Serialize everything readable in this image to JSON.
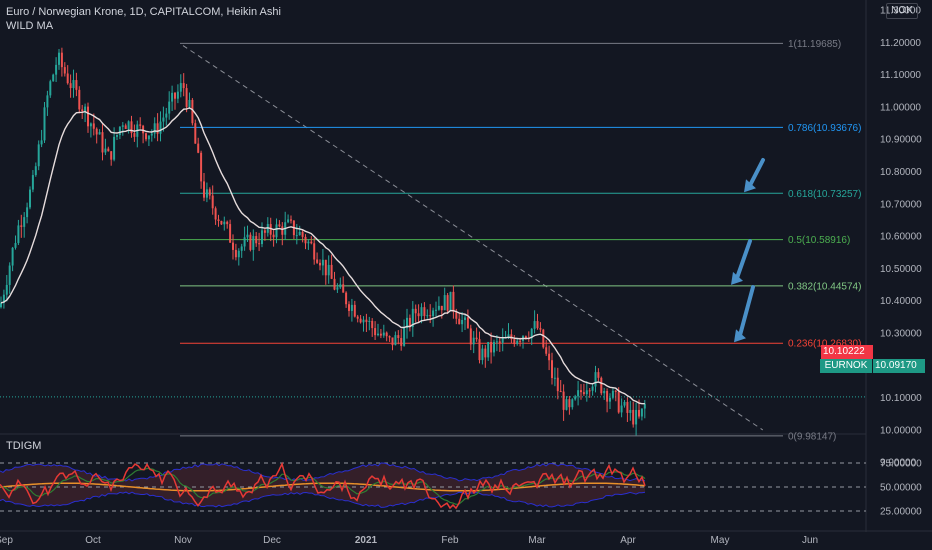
{
  "header": {
    "symbol_line": "Euro / Norwegian Krone, 1D, CAPITALCOM, Heikin Ashi",
    "indicator": "WILD MA",
    "oscillator": "TDIGM",
    "currency": "NOK"
  },
  "price_axis": {
    "ticks": [
      "11.30000",
      "11.20000",
      "11.10000",
      "11.00000",
      "10.90000",
      "10.80000",
      "10.70000",
      "10.60000",
      "10.50000",
      "10.40000",
      "10.30000",
      "10.20000",
      "10.10000",
      "10.00000",
      "9.90000"
    ],
    "tick_values": [
      11.3,
      11.2,
      11.1,
      11.0,
      10.9,
      10.8,
      10.7,
      10.6,
      10.5,
      10.4,
      10.3,
      10.2,
      10.1,
      10.0,
      9.9
    ]
  },
  "osc_axis": {
    "ticks": [
      "75.00000",
      "50.00000",
      "25.00000"
    ],
    "tick_values": [
      75,
      50,
      25
    ]
  },
  "time_axis": {
    "ticks": [
      "Sep",
      "Oct",
      "Nov",
      "Dec",
      "2021",
      "Feb",
      "Mar",
      "Apr",
      "May",
      "Jun"
    ]
  },
  "tags": {
    "last_price": "10.10222",
    "symbol": "EURNOK",
    "symbol_price": "10.09170"
  },
  "chart_data": {
    "type": "candlestick",
    "symbol": "EURNOK",
    "interval": "1D",
    "style": "Heikin Ashi",
    "ylim": [
      9.87,
      11.32
    ],
    "fib_levels": [
      {
        "ratio": "1",
        "value": 11.19685,
        "label": "1(11.19685)",
        "color": "#787b86"
      },
      {
        "ratio": "0.786",
        "value": 10.93676,
        "label": "0.786(10.93676)",
        "color": "#2196f3"
      },
      {
        "ratio": "0.618",
        "value": 10.73257,
        "label": "0.618(10.73257)",
        "color": "#26a69a"
      },
      {
        "ratio": "0.5",
        "value": 10.58916,
        "label": "0.5(10.58916)",
        "color": "#4caf50"
      },
      {
        "ratio": "0.382",
        "value": 10.44574,
        "label": "0.382(10.44574)",
        "color": "#81c784"
      },
      {
        "ratio": "0.236",
        "value": 10.2683,
        "label": "0.236(10.26830)",
        "color": "#f44336"
      },
      {
        "ratio": "0",
        "value": 9.98147,
        "label": "0(9.98147)",
        "color": "#787b86"
      }
    ],
    "trendline": {
      "from": [
        "Nov",
        11.19
      ],
      "to": [
        "May 20",
        10.0
      ]
    },
    "annotations": [
      "arrow at 0.618",
      "arrow at 0.382",
      "arrow at 0.236"
    ],
    "price_path": [
      [
        "Aug 28",
        10.38
      ],
      [
        "Sep 7",
        10.62
      ],
      [
        "Sep 14",
        10.76
      ],
      [
        "Sep 21",
        11.05
      ],
      [
        "Sep 25",
        11.15
      ],
      [
        "Oct 1",
        10.94
      ],
      [
        "Oct 8",
        10.84
      ],
      [
        "Oct 14",
        10.96
      ],
      [
        "Oct 21",
        10.93
      ],
      [
        "Oct 28",
        10.92
      ],
      [
        "Nov 1",
        11.07
      ],
      [
        "Nov 4",
        10.99
      ],
      [
        "Nov 10",
        10.74
      ],
      [
        "Nov 18",
        10.65
      ],
      [
        "Nov 25",
        10.56
      ],
      [
        "Dec 2",
        10.62
      ],
      [
        "Dec 8",
        10.63
      ],
      [
        "Dec 14",
        10.6
      ],
      [
        "Dec 21",
        10.54
      ],
      [
        "Dec 28",
        10.44
      ],
      [
        "Jan 5",
        10.31
      ],
      [
        "Jan 12",
        10.27
      ],
      [
        "Jan 18",
        10.29
      ],
      [
        "Jan 25",
        10.37
      ],
      [
        "Feb 1",
        10.4
      ],
      [
        "Feb 8",
        10.32
      ],
      [
        "Feb 15",
        10.23
      ],
      [
        "Feb 22",
        10.26
      ],
      [
        "Mar 1",
        10.32
      ],
      [
        "Mar 8",
        10.16
      ],
      [
        "Mar 15",
        10.05
      ],
      [
        "Mar 22",
        10.14
      ],
      [
        "Mar 26",
        10.16
      ],
      [
        "Apr 1",
        10.05
      ],
      [
        "Apr 6",
        10.03
      ],
      [
        "Apr 9",
        10.09
      ]
    ],
    "last_price": 10.10222,
    "oscillator": {
      "name": "TDIGM",
      "levels": [
        75,
        50,
        25
      ],
      "ylim": [
        18,
        90
      ]
    }
  },
  "colors": {
    "background": "#131722",
    "up": "#26a69a",
    "down": "#ef5350",
    "ma": "#e6dcdc",
    "last_price_tag": "#f23645",
    "symbol_tag": "#26a69a",
    "arrow": "#4a90c8"
  }
}
